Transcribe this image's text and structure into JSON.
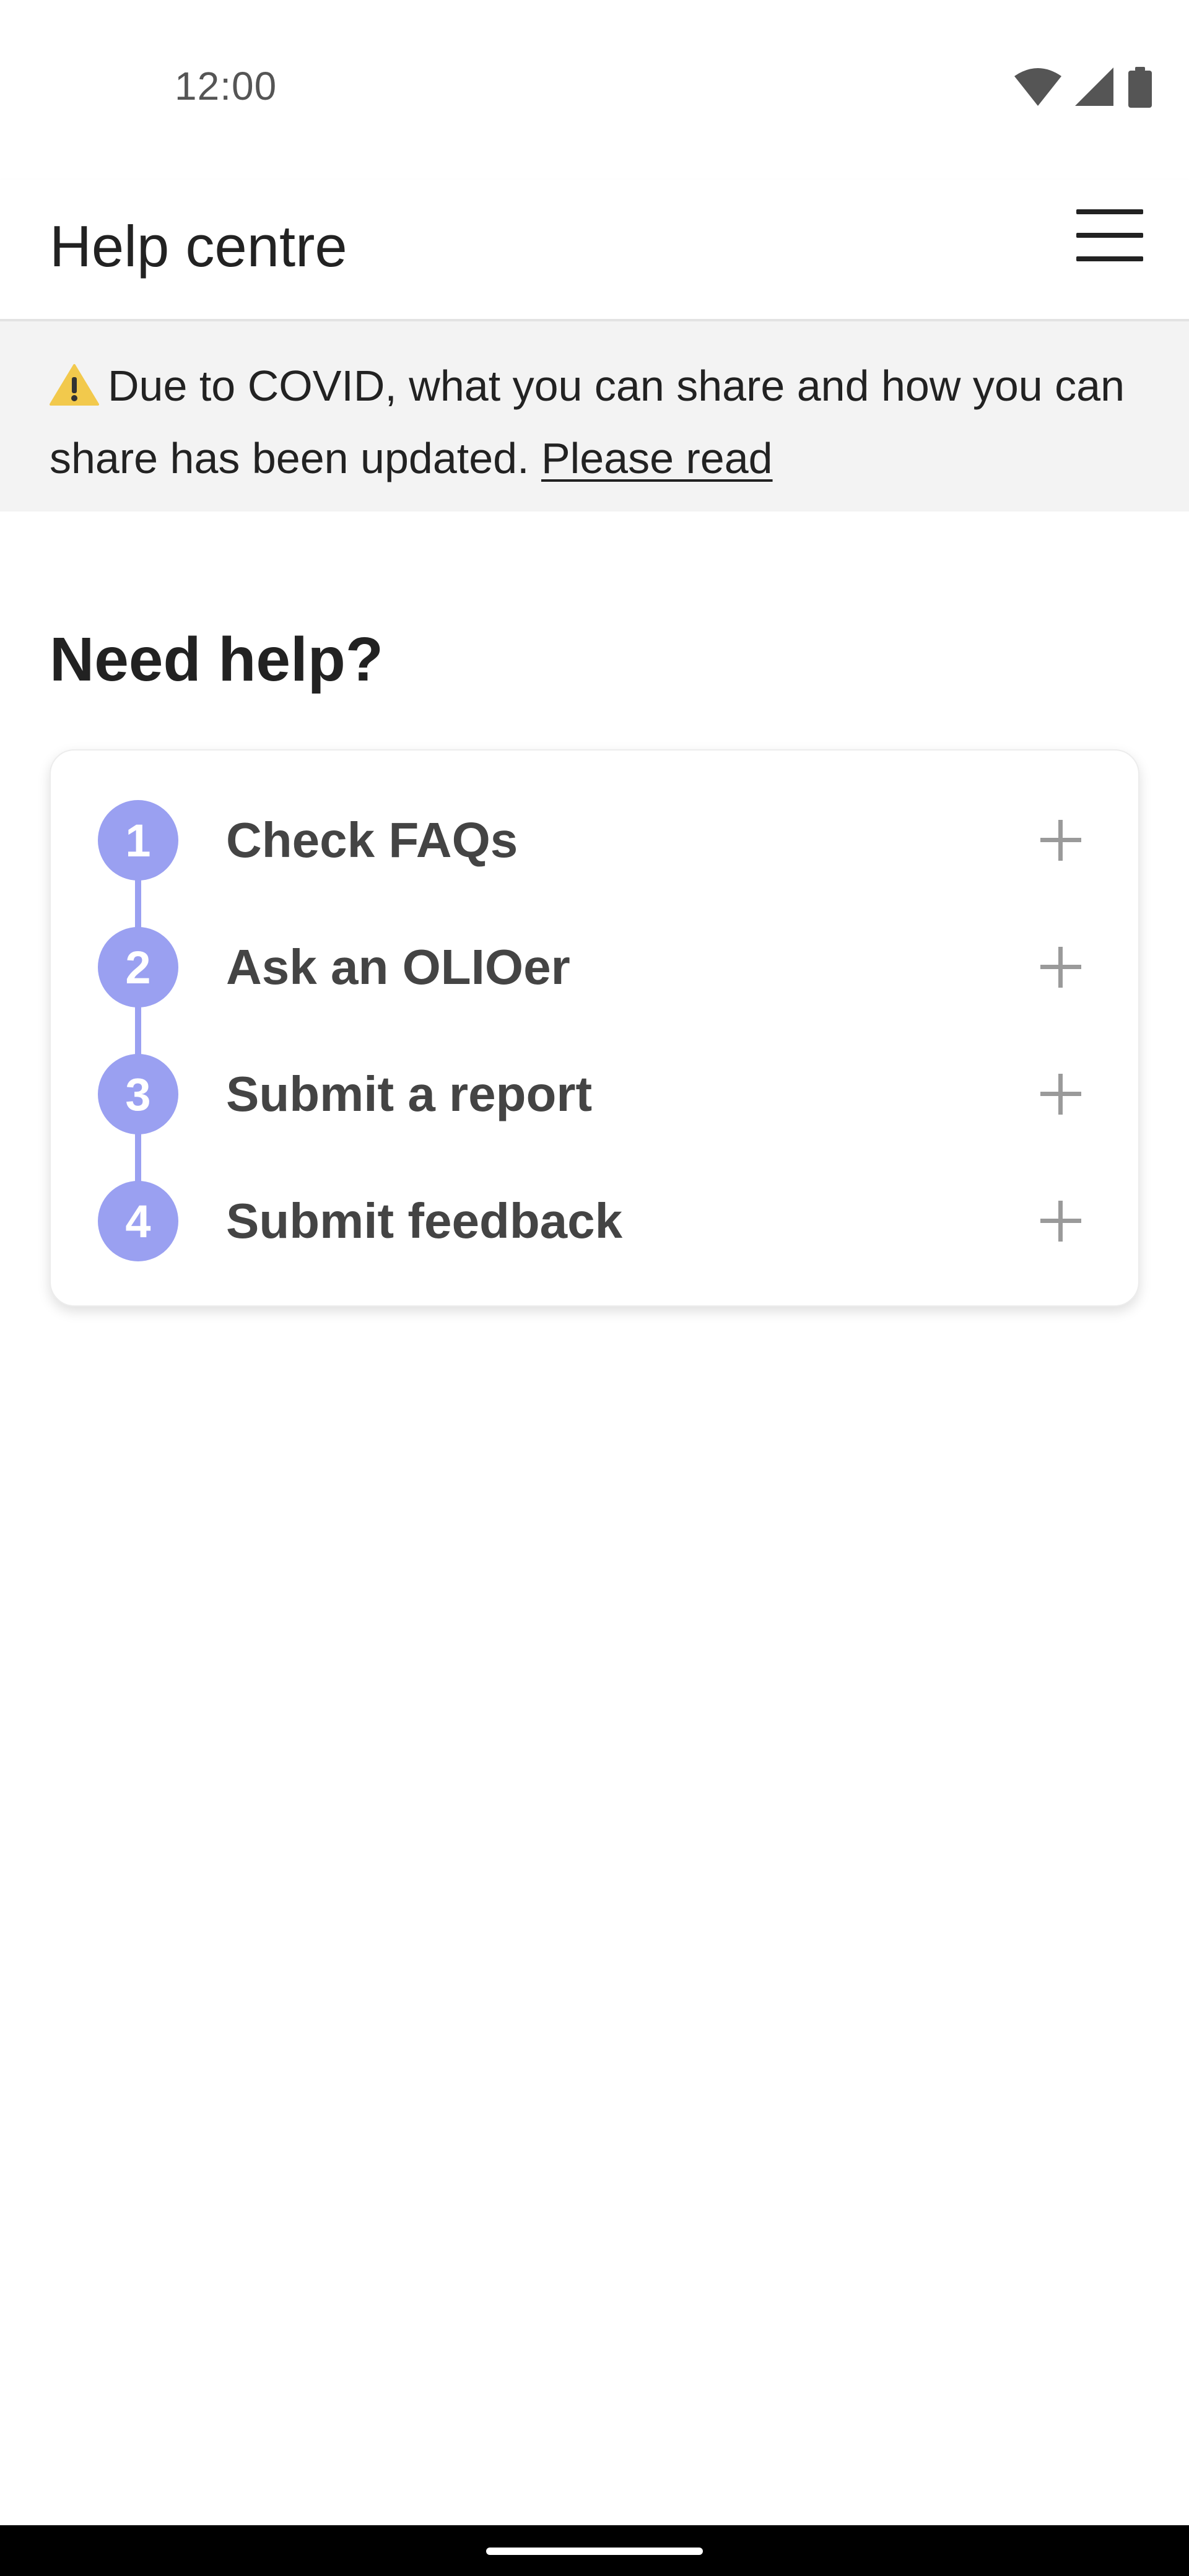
{
  "status_bar": {
    "time": "12:00",
    "icons": [
      "wifi-icon",
      "cell-signal-icon",
      "battery-icon"
    ]
  },
  "app_bar": {
    "title": "Help centre",
    "menu_icon": "hamburger-menu-icon"
  },
  "banner": {
    "icon": "warning-icon",
    "text": "Due to COVID, what you can share and how you can share has been updated.",
    "link_label": "Please read",
    "background_color": "#f3f3f3",
    "warning_color": "#f2c94c"
  },
  "main": {
    "section_title": "Need help?",
    "accent_color": "#9aa0f1",
    "steps": [
      {
        "number": "1",
        "label": "Check FAQs",
        "action_icon": "plus-icon"
      },
      {
        "number": "2",
        "label": "Ask an OLIOer",
        "action_icon": "plus-icon"
      },
      {
        "number": "3",
        "label": "Submit a report",
        "action_icon": "plus-icon"
      },
      {
        "number": "4",
        "label": "Submit feedback",
        "action_icon": "plus-icon"
      }
    ]
  }
}
